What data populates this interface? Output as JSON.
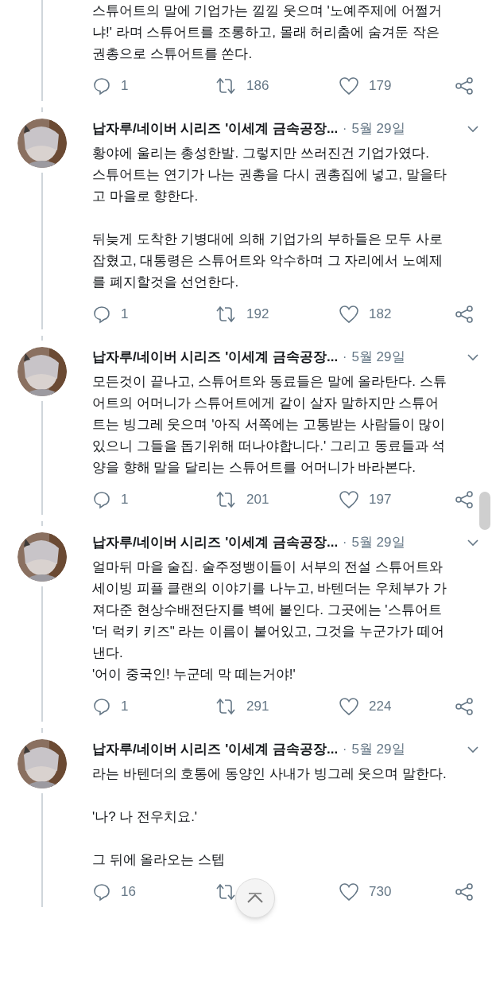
{
  "tweets": [
    {
      "kind": "continuation",
      "text": "스튜어트의 말에 기업가는 낄낄 웃으며 '노예주제에 어쩔거\n냐!' 라며 스튜어트를 조롱하고, 몰래 허리춤에 숨겨둔 작은\n권총으로 스튜어트를 쏜다.",
      "replies": "1",
      "retweets": "186",
      "likes": "179"
    },
    {
      "kind": "tweet",
      "author": "납자루/네이버 시리즈 '이세계 금속공장...",
      "dot": "·",
      "date": "5월 29일",
      "text": "황야에 울리는 총성한발. 그렇지만 쓰러진건 기업가였다.\n스튜어트는 연기가 나는 권총을 다시 권총집에 넣고, 말을타\n고 마을로 향한다.\n\n뒤늦게 도착한 기병대에 의해 기업가의 부하들은 모두 사로\n잡혔고, 대통령은 스튜어트와 악수하며 그 자리에서 노예제\n를 폐지할것을 선언한다.",
      "replies": "1",
      "retweets": "192",
      "likes": "182"
    },
    {
      "kind": "tweet",
      "author": "납자루/네이버 시리즈 '이세계 금속공장...",
      "dot": "·",
      "date": "5월 29일",
      "text": "모든것이 끝나고, 스튜어트와 동료들은 말에 올라탄다. 스튜\n어트의 어머니가 스튜어트에게 같이 살자 말하지만 스튜어\n트는 빙그레 웃으며 '아직 서쪽에는 고통받는 사람들이 많이\n있으니 그들을 돕기위해 떠나야합니다.' 그리고 동료들과 석\n양을 향해 말을 달리는 스튜어트를 어머니가 바라본다.",
      "replies": "1",
      "retweets": "201",
      "likes": "197"
    },
    {
      "kind": "tweet",
      "author": "납자루/네이버 시리즈 '이세계 금속공장...",
      "dot": "·",
      "date": "5월 29일",
      "text": "얼마뒤 마을 술집. 술주정뱅이들이 서부의 전설 스튜어트와\n세이빙 피플 클랜의 이야기를 나누고, 바텐더는 우체부가 가\n져다준 현상수배전단지를 벽에 붙인다. 그곳에는 '스튜어트\n'더 럭키 키즈\" 라는 이름이 붙어있고, 그것을 누군가가 떼어\n낸다.\n'어이 중국인! 누군데 막 떼는거야!'",
      "replies": "1",
      "retweets": "291",
      "likes": "224"
    },
    {
      "kind": "tweet",
      "author": "납자루/네이버 시리즈 '이세계 금속공장...",
      "dot": "·",
      "date": "5월 29일",
      "text": "라는 바텐더의 호통에 동양인 사내가 빙그레 웃으며 말한다.\n\n'나? 나 전우치요.'\n\n그 뒤에 올라오는 스텝",
      "replies": "16",
      "likes": "730"
    }
  ]
}
